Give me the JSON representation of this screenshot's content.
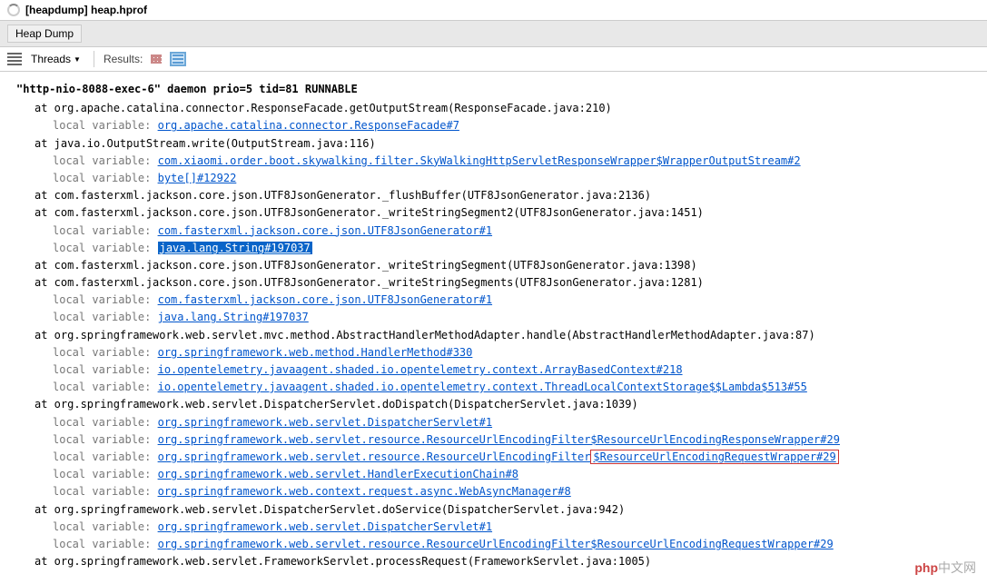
{
  "window": {
    "title_prefix": "[heapdump]",
    "title_file": "heap.hprof"
  },
  "tab": {
    "label": "Heap Dump"
  },
  "toolbar": {
    "threads_label": "Threads",
    "results_label": "Results:"
  },
  "thread": {
    "header": "\"http-nio-8088-exec-6\" daemon prio=5 tid=81 RUNNABLE"
  },
  "frames": [
    {
      "at": "at org.apache.catalina.connector.ResponseFacade.getOutputStream(ResponseFacade.java:210)",
      "locals": [
        {
          "link": "org.apache.catalina.connector.ResponseFacade#7"
        }
      ]
    },
    {
      "at": "at java.io.OutputStream.write(OutputStream.java:116)",
      "locals": [
        {
          "link": "com.xiaomi.order.boot.skywalking.filter.SkyWalkingHttpServletResponseWrapper$WrapperOutputStream#2"
        },
        {
          "link": "byte[]#12922"
        }
      ]
    },
    {
      "at": "at com.fasterxml.jackson.core.json.UTF8JsonGenerator._flushBuffer(UTF8JsonGenerator.java:2136)",
      "locals": []
    },
    {
      "at": "at com.fasterxml.jackson.core.json.UTF8JsonGenerator._writeStringSegment2(UTF8JsonGenerator.java:1451)",
      "locals": [
        {
          "link": "com.fasterxml.jackson.core.json.UTF8JsonGenerator#1"
        },
        {
          "link": "java.lang.String#197037",
          "selected": true
        }
      ]
    },
    {
      "at": "at com.fasterxml.jackson.core.json.UTF8JsonGenerator._writeStringSegment(UTF8JsonGenerator.java:1398)",
      "locals": []
    },
    {
      "at": "at com.fasterxml.jackson.core.json.UTF8JsonGenerator._writeStringSegments(UTF8JsonGenerator.java:1281)",
      "locals": [
        {
          "link": "com.fasterxml.jackson.core.json.UTF8JsonGenerator#1"
        },
        {
          "link": "java.lang.String#197037"
        }
      ]
    },
    {
      "at": "at org.springframework.web.servlet.mvc.method.AbstractHandlerMethodAdapter.handle(AbstractHandlerMethodAdapter.java:87)",
      "locals": [
        {
          "link": "org.springframework.web.method.HandlerMethod#330"
        },
        {
          "link": "io.opentelemetry.javaagent.shaded.io.opentelemetry.context.ArrayBasedContext#218"
        },
        {
          "link": "io.opentelemetry.javaagent.shaded.io.opentelemetry.context.ThreadLocalContextStorage$$Lambda$513#55"
        }
      ]
    },
    {
      "at": "at org.springframework.web.servlet.DispatcherServlet.doDispatch(DispatcherServlet.java:1039)",
      "locals": [
        {
          "link": "org.springframework.web.servlet.DispatcherServlet#1"
        },
        {
          "link": "org.springframework.web.servlet.resource.ResourceUrlEncodingFilter$ResourceUrlEncodingResponseWrapper#29"
        },
        {
          "prefix": "org.springframework.web.servlet.resource.ResourceUrlEncodingFilter",
          "boxed_link": "$ResourceUrlEncodingRequestWrapper#29"
        },
        {
          "link": "org.springframework.web.servlet.HandlerExecutionChain#8"
        },
        {
          "link": "org.springframework.web.context.request.async.WebAsyncManager#8"
        }
      ]
    },
    {
      "at": "at org.springframework.web.servlet.DispatcherServlet.doService(DispatcherServlet.java:942)",
      "locals": [
        {
          "link": "org.springframework.web.servlet.DispatcherServlet#1"
        },
        {
          "link": "org.springframework.web.servlet.resource.ResourceUrlEncodingFilter$ResourceUrlEncodingRequestWrapper#29"
        }
      ]
    },
    {
      "at": "at org.springframework.web.servlet.FrameworkServlet.processRequest(FrameworkServlet.java:1005)",
      "locals": []
    }
  ],
  "local_label": "local variable:",
  "watermark": {
    "brand": "php",
    "suffix": "中文网"
  }
}
